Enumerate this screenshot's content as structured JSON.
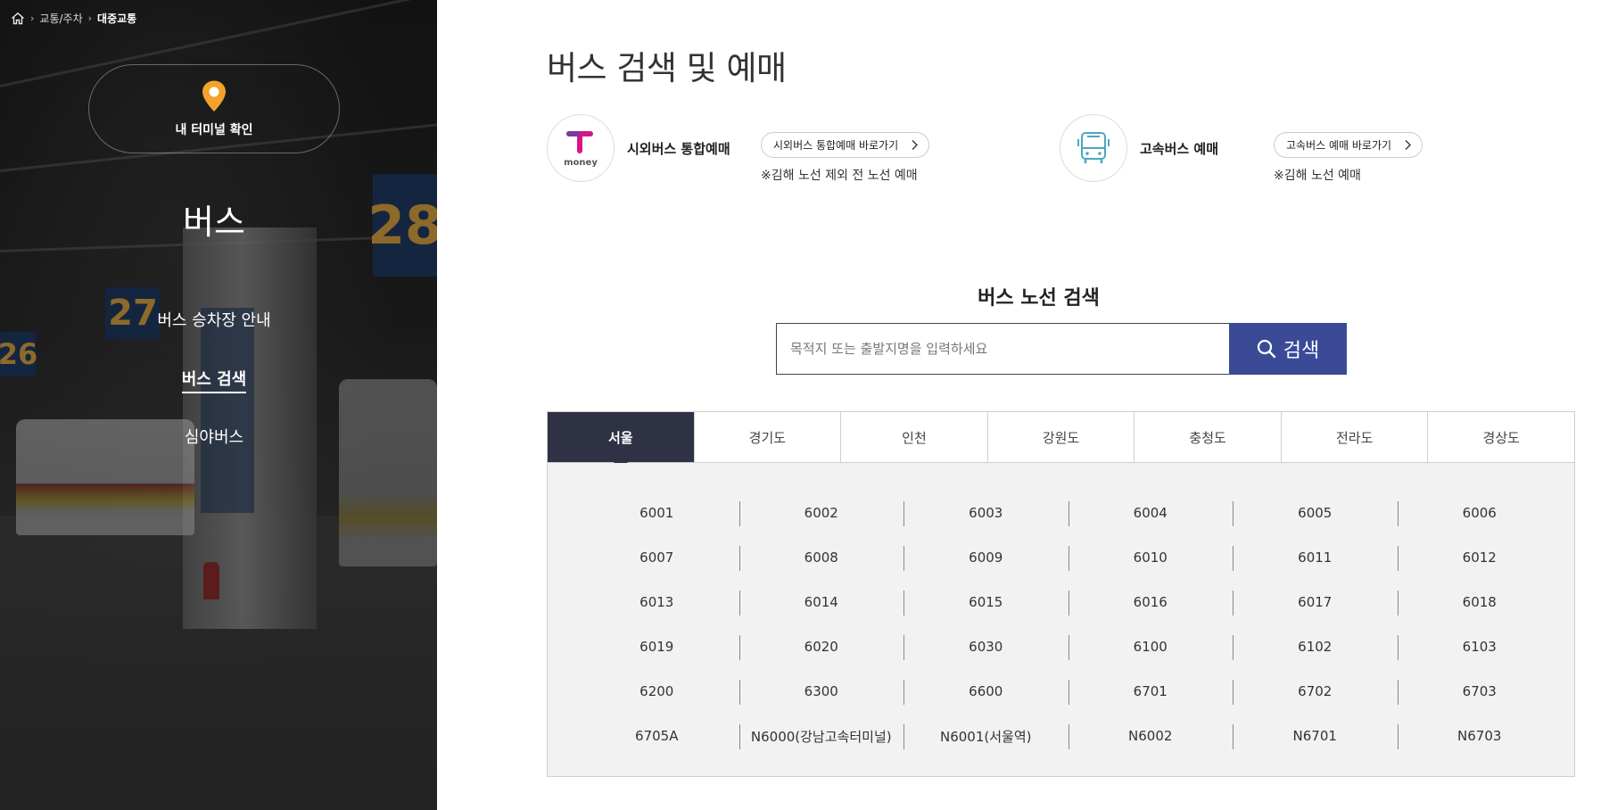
{
  "breadcrumb": {
    "items": [
      "교통/주차",
      "대중교통"
    ]
  },
  "sidebar": {
    "terminal_label": "내 터미널 확인",
    "title": "버스",
    "menu": [
      {
        "label": "버스 승차장 안내"
      },
      {
        "label": "버스 검색"
      },
      {
        "label": "심야버스"
      }
    ],
    "accent_color": "#f3a32b"
  },
  "main": {
    "title": "버스 검색 및 예매",
    "bookings": [
      {
        "logo_text": "money",
        "name": "시외버스 통합예매",
        "link_label": "시외버스 통합예매 바로가기",
        "note": "※김해 노선 제외 전 노선 예매"
      },
      {
        "name": "고속버스 예매",
        "link_label": "고속버스 예매 바로가기",
        "note": "※김해 노선 예매"
      }
    ],
    "route_search": {
      "title": "버스 노선 검색",
      "placeholder": "목적지 또는 출발지명을 입력하세요",
      "button_label": "검색"
    },
    "tabs": [
      {
        "label": "서울",
        "active": true
      },
      {
        "label": "경기도",
        "active": false
      },
      {
        "label": "인천",
        "active": false
      },
      {
        "label": "강원도",
        "active": false
      },
      {
        "label": "충청도",
        "active": false
      },
      {
        "label": "전라도",
        "active": false
      },
      {
        "label": "경상도",
        "active": false
      }
    ],
    "routes": [
      "6001",
      "6002",
      "6003",
      "6004",
      "6005",
      "6006",
      "6007",
      "6008",
      "6009",
      "6010",
      "6011",
      "6012",
      "6013",
      "6014",
      "6015",
      "6016",
      "6017",
      "6018",
      "6019",
      "6020",
      "6030",
      "6100",
      "6102",
      "6103",
      "6200",
      "6300",
      "6600",
      "6701",
      "6702",
      "6703",
      "6705A",
      "N6000(강남고속터미널)",
      "N6001(서울역)",
      "N6002",
      "N6701",
      "N6703"
    ],
    "colors": {
      "search_button": "#3a4a96",
      "active_tab": "#2f3245"
    }
  }
}
